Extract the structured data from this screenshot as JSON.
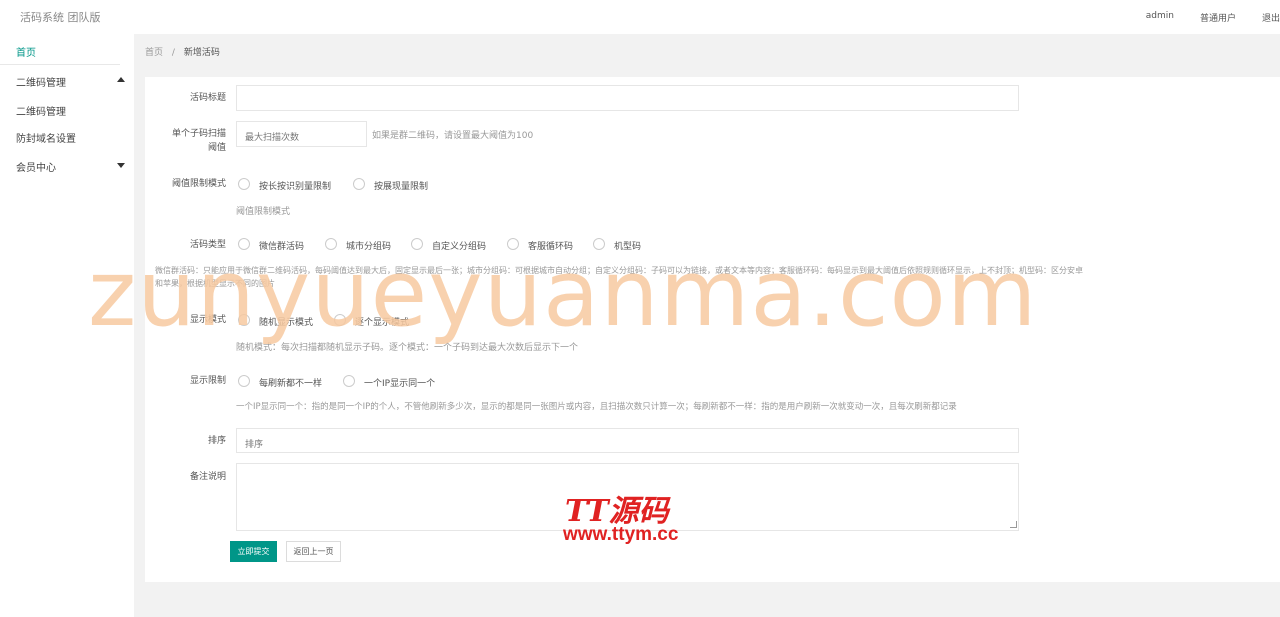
{
  "app": {
    "title": "活码系统 团队版"
  },
  "top": {
    "username": "admin",
    "role": "普通用户",
    "logout": "退出"
  },
  "sidebar": {
    "home": "首页",
    "qr_group": "二维码管理",
    "qr_manage": "二维码管理",
    "domain_settings": "防封域名设置",
    "member_center": "会员中心"
  },
  "breadcrumb": {
    "home": "首页",
    "sep": "/",
    "current": "新增活码"
  },
  "form": {
    "title_label": "活码标题",
    "threshold_label_1": "单个子码扫描",
    "threshold_label_2": "阈值",
    "threshold_placeholder": "最大扫描次数",
    "threshold_hint": "如果是群二维码，请设置最大阈值为100",
    "limit_mode_label": "阈值限制模式",
    "limit_mode_options": [
      "按长按识别量限制",
      "按展现量限制"
    ],
    "limit_mode_hint": "阈值限制模式",
    "type_label": "活码类型",
    "type_options": [
      "微信群活码",
      "城市分组码",
      "自定义分组码",
      "客服循环码",
      "机型码"
    ],
    "type_hint_1": "微信群活码：只能应用于微信群二维码活码，每码阈值达到最大后，固定显示最后一张；城市分组码：可根据城市自动分组；自定义分组码：子码可以为链接，或者文本等内容；客服循环码：每码显示到最大阈值后依照规则循环显示，上不封顶；机型码：区分安卓",
    "type_hint_2": "和苹果，根据机型显示不同的图片",
    "display_mode_label": "显示模式",
    "display_mode_options": [
      "随机显示模式",
      "逐个显示模式"
    ],
    "display_mode_hint": "随机模式：每次扫描都随机显示子码。逐个模式：一个子码到达最大次数后显示下一个",
    "display_limit_label": "显示限制",
    "display_limit_options": [
      "每刷新都不一样",
      "一个IP显示同一个"
    ],
    "display_limit_hint": "一个IP显示同一个：指的是同一个IP的个人，不管他刷新多少次，显示的都是同一张图片或内容，且扫描次数只计算一次；每刷新都不一样：指的是用户刷新一次就变动一次，且每次刷新都记录",
    "sort_label": "排序",
    "sort_placeholder": "排序",
    "remark_label": "备注说明",
    "submit": "立即提交",
    "back": "返回上一页"
  },
  "watermark": {
    "text": "zunyueyuanma.com",
    "logo_top": "TT源码",
    "logo_bottom": "www.ttym.cc"
  }
}
